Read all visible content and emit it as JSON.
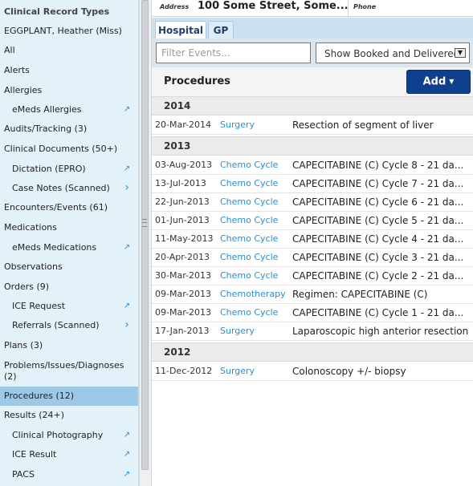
{
  "sidebar": {
    "title": "Clinical Record Types",
    "items": [
      {
        "label": "EGGPLANT, Heather (Miss)",
        "level": 1,
        "icon": ""
      },
      {
        "label": "All",
        "level": 1,
        "icon": ""
      },
      {
        "label": "Alerts",
        "level": 1,
        "icon": ""
      },
      {
        "label": "Allergies",
        "level": 1,
        "icon": ""
      },
      {
        "label": "eMeds Allergies",
        "level": 2,
        "icon": "external-link-icon"
      },
      {
        "label": "Audits/Tracking (3)",
        "level": 1,
        "icon": ""
      },
      {
        "label": "Clinical Documents (50+)",
        "level": 1,
        "icon": ""
      },
      {
        "label": "Dictation (EPRO)",
        "level": 2,
        "icon": "external-link-icon"
      },
      {
        "label": "Case Notes (Scanned)",
        "level": 2,
        "icon": "chevron-right-icon"
      },
      {
        "label": "Encounters/Events (61)",
        "level": 1,
        "icon": ""
      },
      {
        "label": "Medications",
        "level": 1,
        "icon": ""
      },
      {
        "label": "eMeds Medications",
        "level": 2,
        "icon": "external-link-icon"
      },
      {
        "label": "Observations",
        "level": 1,
        "icon": ""
      },
      {
        "label": "Orders (9)",
        "level": 1,
        "icon": ""
      },
      {
        "label": "ICE Request",
        "level": 2,
        "icon": "external-link-icon"
      },
      {
        "label": "Referrals (Scanned)",
        "level": 2,
        "icon": "chevron-right-icon"
      },
      {
        "label": "Plans (3)",
        "level": 1,
        "icon": ""
      },
      {
        "label": "Problems/Issues/Diagnoses (2)",
        "level": 1,
        "icon": ""
      },
      {
        "label": "Procedures (12)",
        "level": 1,
        "icon": "",
        "active": true
      },
      {
        "label": "Results (24+)",
        "level": 1,
        "icon": ""
      },
      {
        "label": "Clinical Photography",
        "level": 2,
        "icon": "external-link-icon"
      },
      {
        "label": "ICE Result",
        "level": 2,
        "icon": "external-link-icon"
      },
      {
        "label": "PACS",
        "level": 2,
        "icon": "external-link-icon"
      }
    ]
  },
  "header": {
    "address_label": "Address",
    "address_value": "100 Some Street, Some...",
    "phone_label": "Phone"
  },
  "tabs": [
    {
      "label": "Hospital",
      "active": true
    },
    {
      "label": "GP",
      "active": false
    }
  ],
  "filter": {
    "placeholder": "Filter Events...",
    "value": "",
    "select_value": "Show Booked and Delivered"
  },
  "procedures": {
    "title": "Procedures",
    "add_label": "Add",
    "groups": [
      {
        "year": "2014",
        "events": [
          {
            "date": "20-Mar-2014",
            "type": "Surgery",
            "description": "Resection of segment of liver"
          }
        ]
      },
      {
        "year": "2013",
        "events": [
          {
            "date": "03-Aug-2013",
            "type": "Chemo Cycle",
            "description": "CAPECITABINE (C) Cycle 8 - 21 da..."
          },
          {
            "date": "13-Jul-2013",
            "type": "Chemo Cycle",
            "description": "CAPECITABINE (C) Cycle 7 - 21 da..."
          },
          {
            "date": "22-Jun-2013",
            "type": "Chemo Cycle",
            "description": "CAPECITABINE (C) Cycle 6 - 21 da..."
          },
          {
            "date": "01-Jun-2013",
            "type": "Chemo Cycle",
            "description": "CAPECITABINE (C) Cycle 5 - 21 da..."
          },
          {
            "date": "11-May-2013",
            "type": "Chemo Cycle",
            "description": "CAPECITABINE (C) Cycle 4 - 21 da..."
          },
          {
            "date": "20-Apr-2013",
            "type": "Chemo Cycle",
            "description": "CAPECITABINE (C) Cycle 3 - 21 da..."
          },
          {
            "date": "30-Mar-2013",
            "type": "Chemo Cycle",
            "description": "CAPECITABINE (C) Cycle 2 - 21 da..."
          },
          {
            "date": "09-Mar-2013",
            "type": "Chemotherapy",
            "description": "Regimen: CAPECITABINE (C)"
          },
          {
            "date": "09-Mar-2013",
            "type": "Chemo Cycle",
            "description": "CAPECITABINE (C) Cycle 1 - 21 da..."
          },
          {
            "date": "17-Jan-2013",
            "type": "Surgery",
            "description": "Laparoscopic high anterior resection"
          }
        ]
      },
      {
        "year": "2012",
        "events": [
          {
            "date": "11-Dec-2012",
            "type": "Surgery",
            "description": "Colonoscopy +/- biopsy"
          }
        ]
      }
    ]
  },
  "colors": {
    "sidebar_bg": "#e3f1f9",
    "sidebar_active": "#9cc9e8",
    "link_blue": "#2a8fd0",
    "add_button": "#103f8e",
    "tabbar_bg": "#c9e1f2"
  }
}
